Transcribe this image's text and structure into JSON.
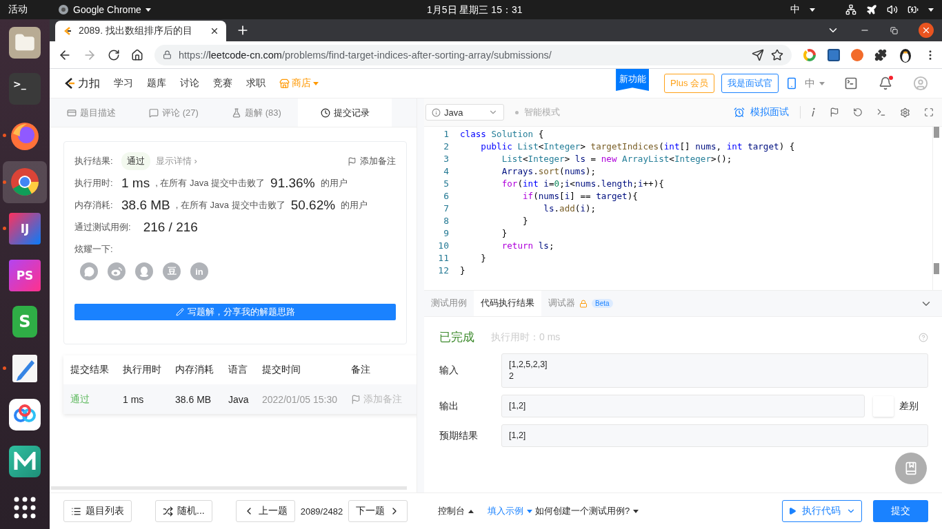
{
  "system_bar": {
    "activities": "活动",
    "app": "Google Chrome",
    "clock": "1月5日 星期三 15：31",
    "input_method": "中"
  },
  "dock": [
    {
      "kind": "files",
      "running": false,
      "selected": false
    },
    {
      "kind": "terminal",
      "label": ">_",
      "running": false,
      "selected": false
    },
    {
      "kind": "firefox",
      "running": true,
      "selected": false
    },
    {
      "kind": "chrome",
      "running": true,
      "selected": true
    },
    {
      "kind": "ide",
      "label": "IJ",
      "running": true,
      "selected": false
    },
    {
      "kind": "ide2",
      "label": "PS",
      "running": false,
      "selected": false
    },
    {
      "kind": "sheet",
      "label": "S",
      "running": false,
      "selected": false
    },
    {
      "kind": "editor",
      "running": true,
      "selected": false
    },
    {
      "kind": "netdisk",
      "running": false,
      "selected": false
    },
    {
      "kind": "mind",
      "running": false,
      "selected": false
    },
    {
      "kind": "grid",
      "running": false,
      "selected": false
    }
  ],
  "browser": {
    "tab_title": "2089. 找出数组排序后的目",
    "url": {
      "scheme": "https://",
      "host": "leetcode-cn.com",
      "path": "/problems/find-target-indices-after-sorting-array/submissions/"
    }
  },
  "nav": {
    "logo": "力扣",
    "items": [
      "学习",
      "题库",
      "讨论",
      "竞赛",
      "求职"
    ],
    "store": "商店",
    "ribbon": "新功能",
    "plus": "Plus 会员",
    "interviewer": "我是面试官",
    "language": "中"
  },
  "left_tabs": [
    {
      "label": "题目描述",
      "selected": false
    },
    {
      "label": "评论 (27)",
      "selected": false
    },
    {
      "label": "题解 (83)",
      "selected": false
    },
    {
      "label": "提交记录",
      "selected": true
    }
  ],
  "result": {
    "status_label": "执行结果:",
    "status": "通过",
    "details": "显示详情 ›",
    "add_note": "添加备注",
    "stats": [
      {
        "label": "执行用时:",
        "value": "1 ms",
        "text": ", 在所有 Java 提交中击败了",
        "percent": "91.36%",
        "suffix": "的用户"
      },
      {
        "label": "内存消耗:",
        "value": "38.6 MB",
        "text": ", 在所有 Java 提交中击败了",
        "percent": "50.62%",
        "suffix": "的用户"
      }
    ],
    "cases_label": "通过测试用例:",
    "cases": "216 / 216",
    "share_label": "炫耀一下:",
    "share": [
      {
        "kind": "wechat"
      },
      {
        "kind": "weibo"
      },
      {
        "kind": "qq"
      },
      {
        "kind": "text",
        "label": "豆"
      },
      {
        "kind": "text",
        "label": "in"
      }
    ],
    "write_button": "写题解，分享我的解题思路"
  },
  "submissions": {
    "columns": [
      "提交结果",
      "执行用时",
      "内存消耗",
      "语言",
      "提交时间",
      "备注"
    ],
    "rows": [
      {
        "status": "通过",
        "runtime": "1 ms",
        "memory": "38.6 MB",
        "language": "Java",
        "time": "2022/01/05 15:30",
        "note": "添加备注"
      }
    ]
  },
  "footer_left": {
    "list": "题目列表",
    "random": "随机...",
    "prev": "上一题",
    "counter": "2089/2482",
    "next": "下一题"
  },
  "editor": {
    "language": "Java",
    "smart_mode": "智能模式",
    "mock": "模拟面试",
    "lines": [
      {
        "number": "1",
        "tokens": [
          {
            "kind": "keyword",
            "text": "class "
          },
          {
            "kind": "type",
            "text": "Solution "
          },
          {
            "kind": "plain",
            "text": "{"
          }
        ]
      },
      {
        "number": "2",
        "tokens": [
          {
            "kind": "keyword",
            "text": "    public "
          },
          {
            "kind": "type",
            "text": "List"
          },
          {
            "kind": "plain",
            "text": "<"
          },
          {
            "kind": "type",
            "text": "Integer"
          },
          {
            "kind": "plain",
            "text": "> "
          },
          {
            "kind": "function",
            "text": "targetIndices"
          },
          {
            "kind": "plain",
            "text": "("
          },
          {
            "kind": "keyword",
            "text": "int"
          },
          {
            "kind": "plain",
            "text": "[] "
          },
          {
            "kind": "variable",
            "text": "nums"
          },
          {
            "kind": "plain",
            "text": ", "
          },
          {
            "kind": "keyword",
            "text": "int "
          },
          {
            "kind": "variable",
            "text": "target"
          },
          {
            "kind": "plain",
            "text": ") {"
          }
        ]
      },
      {
        "number": "3",
        "tokens": [
          {
            "kind": "type",
            "text": "        List"
          },
          {
            "kind": "plain",
            "text": "<"
          },
          {
            "kind": "type",
            "text": "Integer"
          },
          {
            "kind": "plain",
            "text": "> "
          },
          {
            "kind": "variable",
            "text": "ls"
          },
          {
            "kind": "plain",
            "text": " = "
          },
          {
            "kind": "control",
            "text": "new "
          },
          {
            "kind": "type",
            "text": "ArrayList"
          },
          {
            "kind": "plain",
            "text": "<"
          },
          {
            "kind": "type",
            "text": "Integer"
          },
          {
            "kind": "plain",
            "text": ">();"
          }
        ]
      },
      {
        "number": "4",
        "tokens": [
          {
            "kind": "variable",
            "text": "        Arrays"
          },
          {
            "kind": "plain",
            "text": "."
          },
          {
            "kind": "function",
            "text": "sort"
          },
          {
            "kind": "plain",
            "text": "("
          },
          {
            "kind": "variable",
            "text": "nums"
          },
          {
            "kind": "plain",
            "text": ");"
          }
        ]
      },
      {
        "number": "5",
        "tokens": [
          {
            "kind": "control",
            "text": "        for"
          },
          {
            "kind": "plain",
            "text": "("
          },
          {
            "kind": "keyword",
            "text": "int "
          },
          {
            "kind": "variable",
            "text": "i"
          },
          {
            "kind": "plain",
            "text": "="
          },
          {
            "kind": "number",
            "text": "0"
          },
          {
            "kind": "plain",
            "text": ";"
          },
          {
            "kind": "variable",
            "text": "i"
          },
          {
            "kind": "plain",
            "text": "<"
          },
          {
            "kind": "variable",
            "text": "nums"
          },
          {
            "kind": "plain",
            "text": "."
          },
          {
            "kind": "variable",
            "text": "length"
          },
          {
            "kind": "plain",
            "text": ";"
          },
          {
            "kind": "variable",
            "text": "i"
          },
          {
            "kind": "plain",
            "text": "++){"
          }
        ]
      },
      {
        "number": "6",
        "tokens": [
          {
            "kind": "control",
            "text": "            if"
          },
          {
            "kind": "plain",
            "text": "("
          },
          {
            "kind": "variable",
            "text": "nums"
          },
          {
            "kind": "plain",
            "text": "["
          },
          {
            "kind": "variable",
            "text": "i"
          },
          {
            "kind": "plain",
            "text": "] == "
          },
          {
            "kind": "variable",
            "text": "target"
          },
          {
            "kind": "plain",
            "text": "){"
          }
        ]
      },
      {
        "number": "7",
        "tokens": [
          {
            "kind": "variable",
            "text": "                ls"
          },
          {
            "kind": "plain",
            "text": "."
          },
          {
            "kind": "function",
            "text": "add"
          },
          {
            "kind": "plain",
            "text": "("
          },
          {
            "kind": "variable",
            "text": "i"
          },
          {
            "kind": "plain",
            "text": ");"
          }
        ]
      },
      {
        "number": "8",
        "tokens": [
          {
            "kind": "plain",
            "text": "            }"
          }
        ]
      },
      {
        "number": "9",
        "tokens": [
          {
            "kind": "plain",
            "text": "        }"
          }
        ]
      },
      {
        "number": "10",
        "tokens": [
          {
            "kind": "control",
            "text": "        return "
          },
          {
            "kind": "variable",
            "text": "ls"
          },
          {
            "kind": "plain",
            "text": ";"
          }
        ]
      },
      {
        "number": "11",
        "tokens": [
          {
            "kind": "plain",
            "text": "    }"
          }
        ]
      },
      {
        "number": "12",
        "tokens": [
          {
            "kind": "plain",
            "text": "}"
          }
        ]
      }
    ]
  },
  "console": {
    "tabs": [
      {
        "label": "测试用例",
        "locked": false,
        "selected": false
      },
      {
        "label": "代码执行结果",
        "locked": false,
        "selected": true
      },
      {
        "label": "调试器",
        "locked": true,
        "badge": "Beta",
        "selected": false
      }
    ],
    "status": "已完成",
    "runtime": "执行用时：0 ms",
    "fields": [
      {
        "label": "输入",
        "lines": [
          "[1,2,5,2,3]",
          "2"
        ]
      },
      {
        "label": "输出",
        "lines": [
          "[1,2]"
        ],
        "diff": "差别"
      },
      {
        "label": "预期结果",
        "lines": [
          "[1,2]"
        ]
      }
    ]
  },
  "footer_right": {
    "console": "控制台",
    "fill": "填入示例",
    "howto": "如何创建一个测试用例?",
    "run": "执行代码",
    "submit": "提交"
  }
}
